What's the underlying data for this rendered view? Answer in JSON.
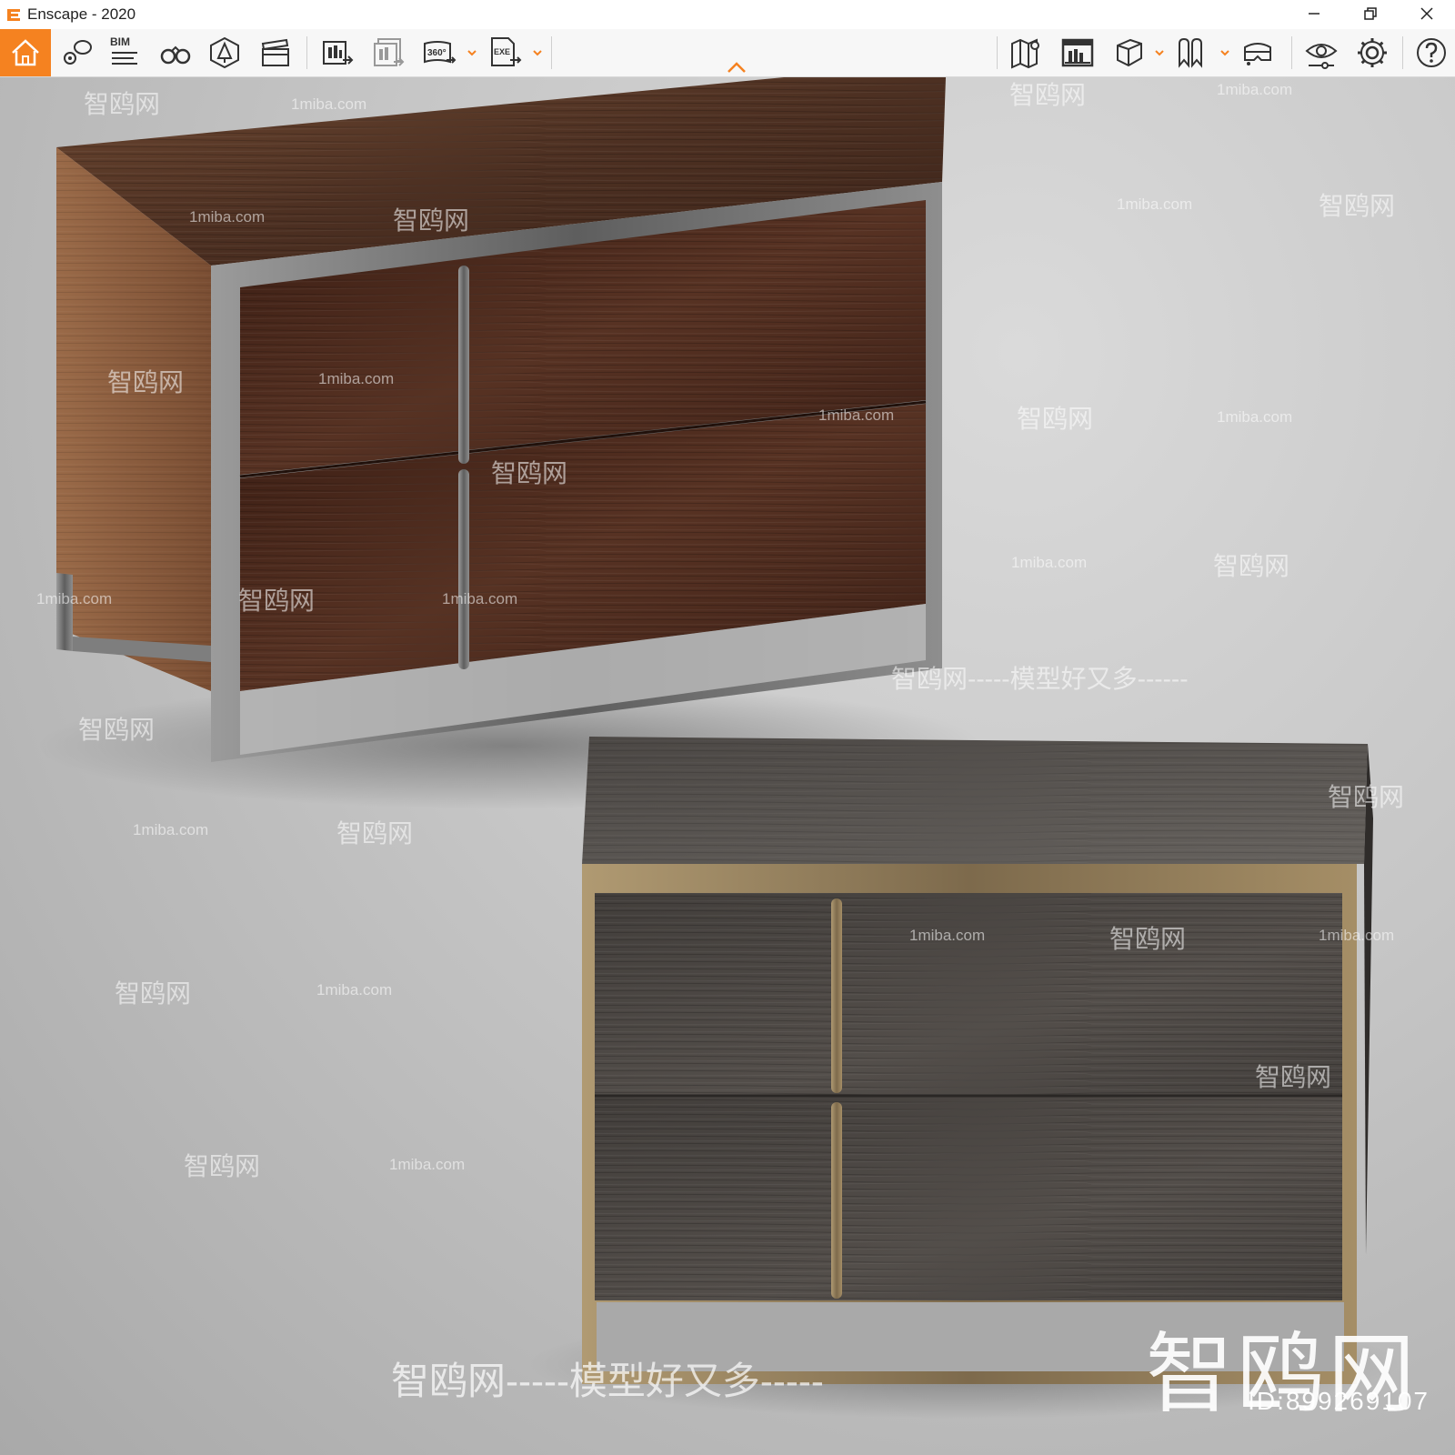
{
  "window": {
    "title": "Enscape - 2020",
    "controls": [
      "minimize",
      "restore",
      "close"
    ]
  },
  "toolbar": {
    "accent_color": "#f58220",
    "items": [
      {
        "name": "home",
        "icon": "home-icon",
        "active": true
      },
      {
        "name": "views",
        "icon": "views-icon"
      },
      {
        "name": "bim",
        "icon": "bim-icon",
        "label": "BIM"
      },
      {
        "name": "walk-mode",
        "icon": "binoculars-icon"
      },
      {
        "name": "asset-library",
        "icon": "asset-library-icon"
      },
      {
        "name": "video-editor",
        "icon": "clapperboard-icon"
      },
      {
        "name": "screenshot-export",
        "icon": "render-export-icon"
      },
      {
        "name": "batch-export",
        "icon": "batch-export-icon"
      },
      {
        "name": "panorama-export",
        "icon": "panorama-360-icon",
        "label": "360°",
        "dropdown": true
      },
      {
        "name": "exe-export",
        "icon": "exe-export-icon",
        "label": "EXE",
        "dropdown": true
      },
      {
        "name": "map",
        "icon": "map-icon"
      },
      {
        "name": "views-manager",
        "icon": "views-manager-icon"
      },
      {
        "name": "object-box",
        "icon": "cube-icon",
        "dropdown": true
      },
      {
        "name": "bookmarks",
        "icon": "bookmark-icon",
        "dropdown": true
      },
      {
        "name": "vr-headset",
        "icon": "vr-headset-icon"
      },
      {
        "name": "visual-settings",
        "icon": "eye-settings-icon"
      },
      {
        "name": "settings",
        "icon": "gear-icon"
      },
      {
        "name": "help",
        "icon": "help-icon"
      }
    ]
  },
  "watermarks": {
    "site": "1miba.com",
    "brand": "智鸥网",
    "dashes": "-----",
    "slogan": "智鸥网-----模型好又多-----",
    "slogan_mid": "智鸥网-----模型好又多------",
    "brand_big": "智鸥网",
    "id": "ID:899269107"
  },
  "scene": {
    "description_objects": [
      "nightstand-walnut",
      "nightstand-dark-oak"
    ],
    "colors": {
      "walnut_side": "#8a5a3a",
      "walnut_top": "#5a3a25",
      "front_dark": "#4a2a1c",
      "steel_frame": "#7a7a7a",
      "dark_oak": "#4a4643",
      "dark_oak_top": "#5d5955",
      "bronze_frame": "#9a8460"
    }
  }
}
